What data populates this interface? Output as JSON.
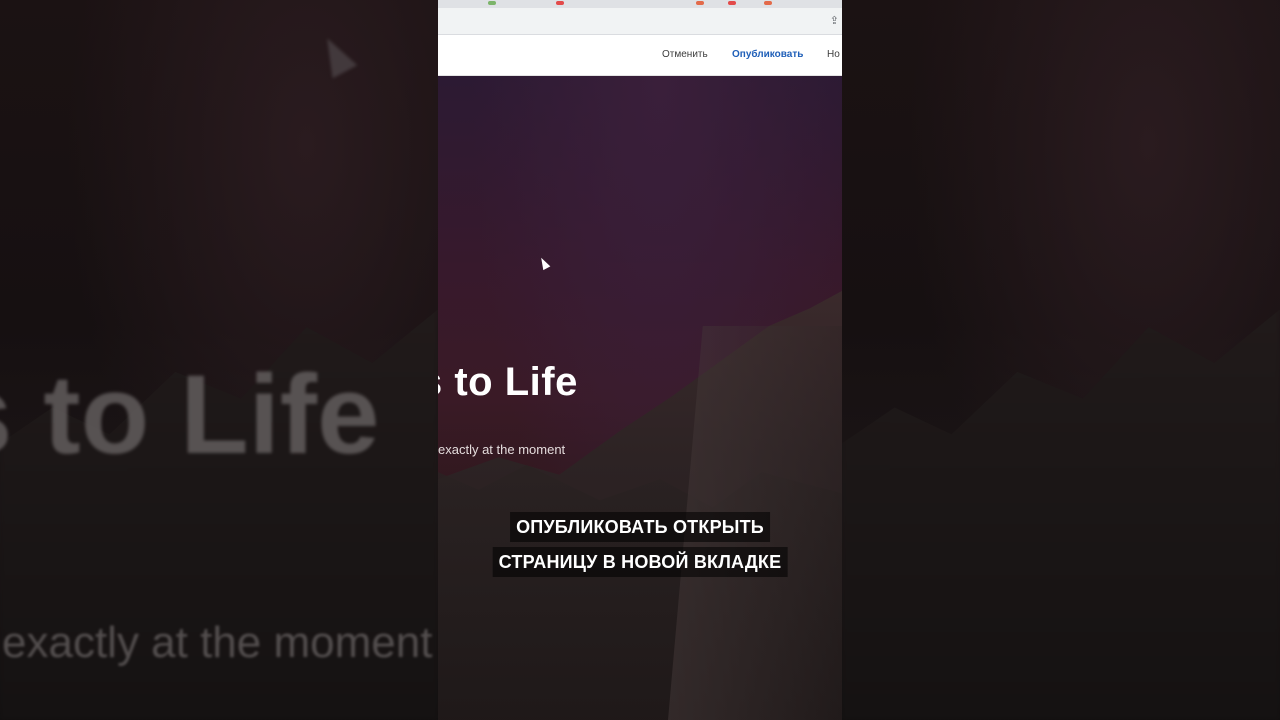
{
  "editor_bar": {
    "cancel_label": "Отменить",
    "publish_label": "Опубликовать",
    "next_label_partial": "Но"
  },
  "hero": {
    "title_partial": "s to Life",
    "subtitle_partial": "exactly at the moment"
  },
  "background": {
    "title_partial": "s to Life",
    "subtitle_partial": "exactly at the moment"
  },
  "captions": {
    "line1": "ОПУБЛИКОВАТЬ ОТКРЫТЬ",
    "line2": "СТРАНИЦУ В НОВОЙ ВКЛАДКЕ"
  },
  "icons": {
    "share": "share-icon",
    "cursor": "mouse-cursor-icon"
  },
  "colors": {
    "publish_accent": "#1f5fb8",
    "hero_sky": "#37192c"
  }
}
